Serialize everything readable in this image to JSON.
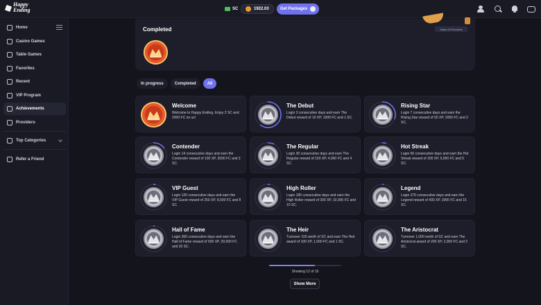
{
  "header": {
    "logo_line1": "Happy",
    "logo_line2": "Ending",
    "sc_label": "SC",
    "fc_balance": "1922.03",
    "get_packages_label": "Get Packages"
  },
  "sidebar": {
    "items": [
      {
        "label": "Home",
        "icon": "home-icon"
      },
      {
        "label": "Casino Games",
        "icon": "casino-icon"
      },
      {
        "label": "Table Games",
        "icon": "table-games-icon"
      },
      {
        "label": "Favorites",
        "icon": "favorites-icon"
      },
      {
        "label": "Recent",
        "icon": "recent-icon"
      },
      {
        "label": "VIP Program",
        "icon": "vip-icon"
      },
      {
        "label": "Achievements",
        "icon": "achievements-icon"
      },
      {
        "label": "Providers",
        "icon": "providers-icon"
      },
      {
        "label": "Top Categories",
        "icon": "categories-icon"
      },
      {
        "label": "Refer a Friend",
        "icon": "refer-icon"
      }
    ]
  },
  "completed": {
    "title": "Completed",
    "make_all_label": "Make All Rewards"
  },
  "filters": [
    "In progress",
    "Completed",
    "All"
  ],
  "achievements": [
    {
      "title": "Welcome",
      "desc": "Welcome to Happy Ending. Enjoy 2 SC and 2000 FC on us!",
      "progress": 1.0
    },
    {
      "title": "The Debut",
      "desc": "Login 3 consecutive days and earn The Debut reward of 10 XP, 1000 FC and 1 SC.",
      "progress": 0.6
    },
    {
      "title": "Rising Star",
      "desc": "Login 7 consecutive days and earn the Rising Star reward of 50 XP, 2000 FC and 2 SC.",
      "progress": 0.3
    },
    {
      "title": "Contender",
      "desc": "Login 14 consecutive days and earn the Contender reward of 100 XP, 3000 FC and 3 SC.",
      "progress": 0.15
    },
    {
      "title": "The Regular",
      "desc": "Login 30 consecutive days and earn The Regular reward of 150 XP, 4,000 FC and 4 SC.",
      "progress": 0.07
    },
    {
      "title": "Hot Streak",
      "desc": "Login 60 consecutive days and earn the Hot Streak reward of 200 XP, 5,000 FC and 5 SC.",
      "progress": 0.04
    },
    {
      "title": "VIP Guest",
      "desc": "Login 120 consecutive days and earn the VIP Guest reward of 250 XP, 8,000 FC and 8 SC.",
      "progress": 0.02
    },
    {
      "title": "High Roller",
      "desc": "Login 180 consecutive days and earn the High Roller reward of 300 XP, 10,000 FC and 10 SC.",
      "progress": 0.02
    },
    {
      "title": "Legend",
      "desc": "Login 270 consecutive days and earn the Legend reward of 400 XP, 2000 FC and 15 SC.",
      "progress": 0.01
    },
    {
      "title": "Hall of Fame",
      "desc": "Login 360 consecutive days and earn the Hall of Fame reward of 500 XP, 20,000 FC and 20 SC.",
      "progress": 0.01
    },
    {
      "title": "The Heir",
      "desc": "Turnover 100 worth of SC and earn The Heir award of  100 XP, 1,000 FC and 1 SC.",
      "progress": 0.0
    },
    {
      "title": "The Aristocrat",
      "desc": "Turnover 1,000 worth of SC and earn The Aristocrat award of  200 XP, 2,000 FC and 2 SC.",
      "progress": 0.0
    }
  ],
  "pagination": {
    "showing_text": "Showing 12 of 19",
    "progress_fraction": 0.63,
    "show_more_label": "Show More"
  },
  "colors": {
    "accent": "#6f72ec",
    "badge_gold": "#e8592b",
    "badge_silver": "#bfc0c8"
  }
}
